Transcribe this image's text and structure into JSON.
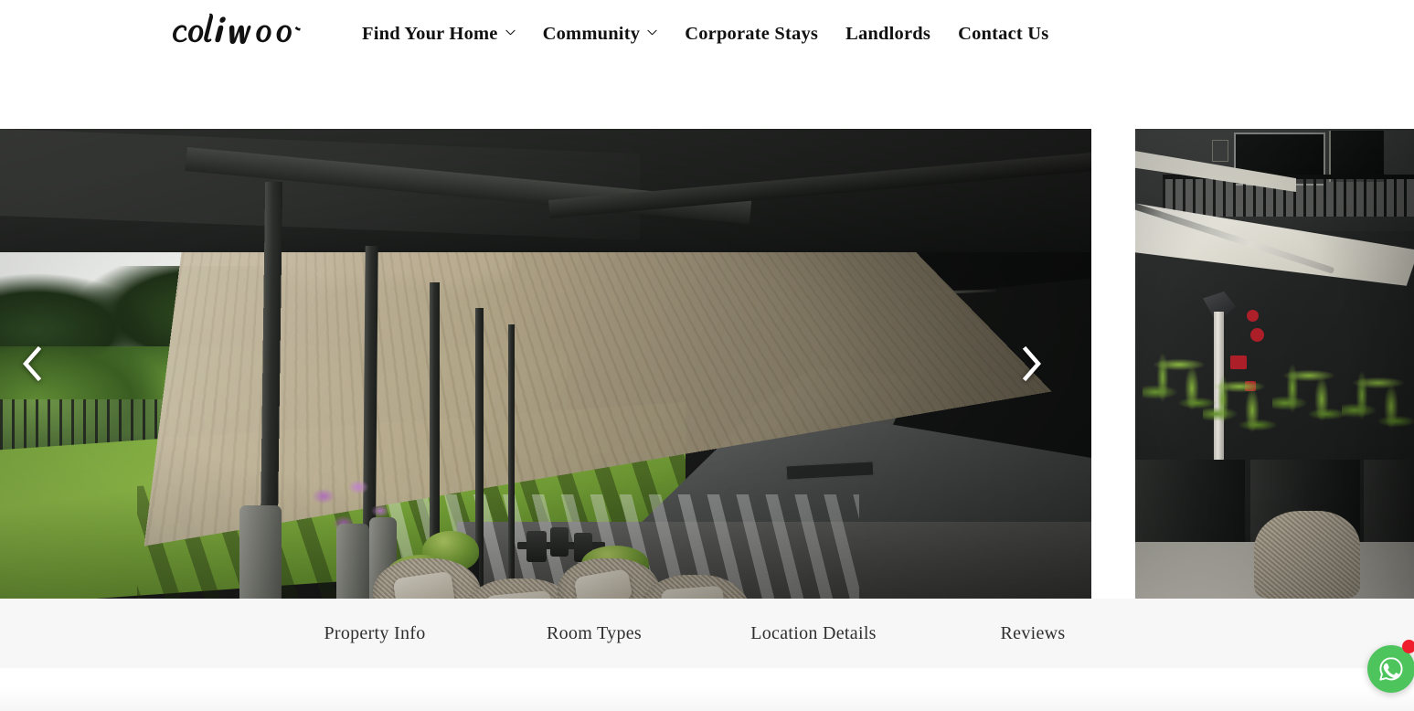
{
  "site": {
    "brand": "coliwoo",
    "logo_icon": "coliwoo-script-wordmark"
  },
  "header": {
    "nav": [
      {
        "label": "Find Your Home",
        "has_dropdown": true,
        "icon": "chevron-down-icon"
      },
      {
        "label": "Community",
        "has_dropdown": true,
        "icon": "chevron-down-icon"
      },
      {
        "label": "Corporate Stays",
        "has_dropdown": false,
        "icon": ""
      },
      {
        "label": "Landlords",
        "has_dropdown": false,
        "icon": ""
      },
      {
        "label": "Contact Us",
        "has_dropdown": false,
        "icon": ""
      }
    ]
  },
  "carousel": {
    "prev_icon": "chevron-left-icon",
    "next_icon": "chevron-right-icon",
    "slides": [
      {
        "alt": "Rooftop terrace with timber pergola, green lawn, tall planters and wicker lounge seating beside a dark corridor walkway",
        "position": "current"
      },
      {
        "alt": "White cantilever umbrella shading outdoor seating with lady palms in dark planters",
        "position": "next"
      }
    ]
  },
  "tabs": {
    "items": [
      {
        "label": "Property Info",
        "active": false
      },
      {
        "label": "Room Types",
        "active": false
      },
      {
        "label": "Location Details",
        "active": false
      },
      {
        "label": "Reviews",
        "active": false
      }
    ]
  },
  "floating_action": {
    "icon": "whatsapp-icon",
    "label": "WhatsApp",
    "badge": "",
    "badge_icon": "notification-dot",
    "color": "#4dc45c",
    "badge_color": "#f01f2c"
  },
  "colors": {
    "header_bg": "#ffffff",
    "tabbar_bg": "#f7f7f7",
    "nav_text": "#111111",
    "tab_text": "#2f2f2f",
    "page_bg": "#ffffff"
  }
}
